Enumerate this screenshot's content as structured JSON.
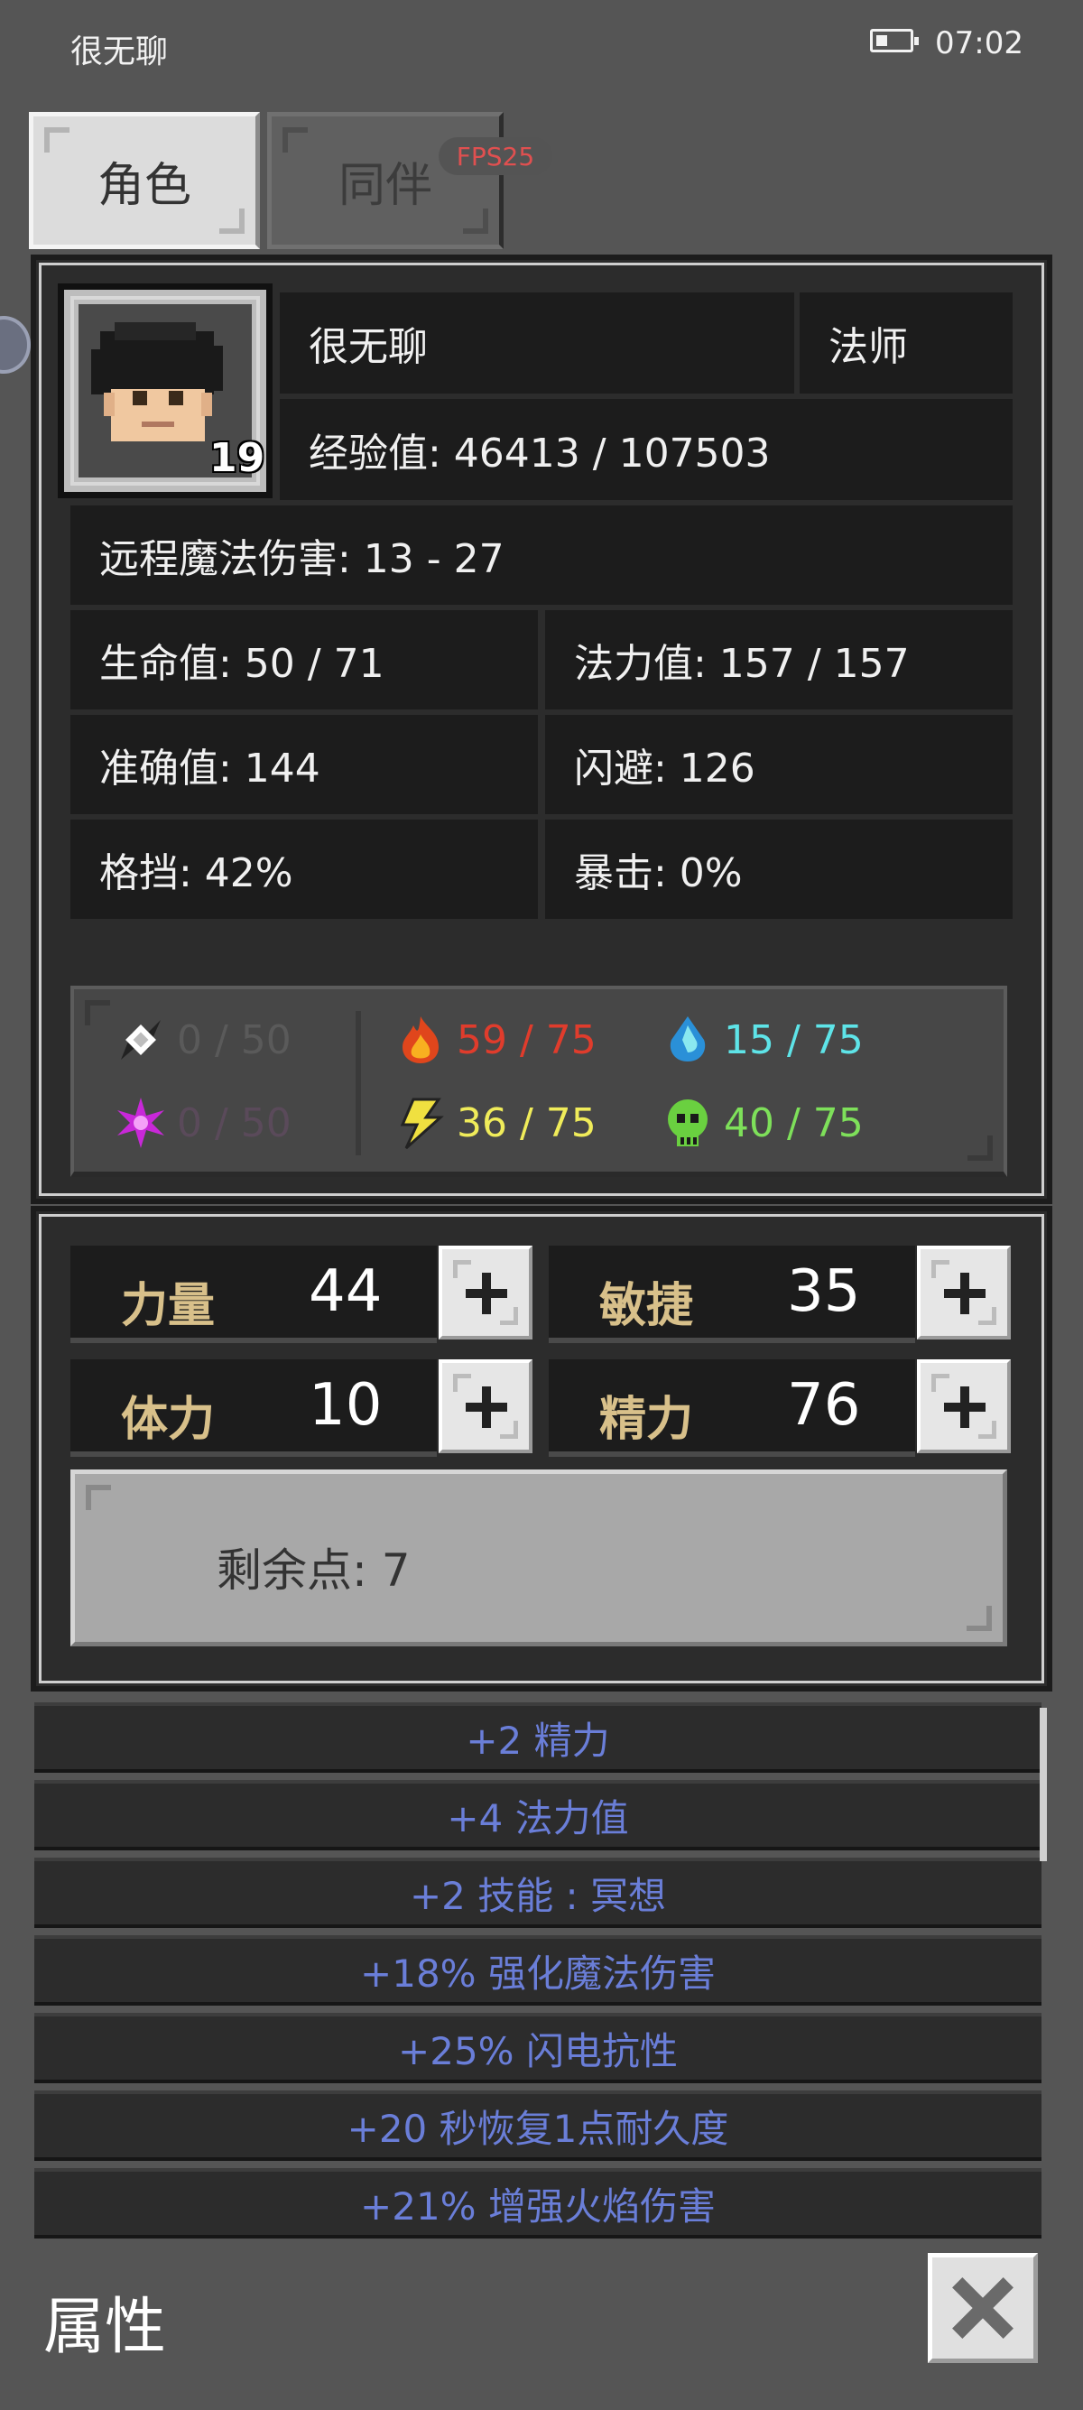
{
  "status_bar": {
    "app_name": "很无聊",
    "time": "07:02"
  },
  "tabs": [
    {
      "label": "角色",
      "active": true
    },
    {
      "label": "同伴",
      "active": false
    }
  ],
  "fps_badge": "FPS25",
  "character": {
    "name": "很无聊",
    "class": "法师",
    "level": "19",
    "experience": "经验值: 46413 / 107503",
    "damage": "远程魔法伤害: 13 - 27",
    "hp": "生命值: 50 / 71",
    "mp": "法力值: 157 / 157",
    "accuracy": "准确值: 144",
    "evasion": "闪避: 126",
    "block": "格挡: 42%",
    "critical": "暴击: 0%"
  },
  "resistances": [
    {
      "icon": "physical-icon",
      "value": "0 / 50",
      "color": "#5a5a5a"
    },
    {
      "icon": "fire-icon",
      "value": "59 / 75",
      "color": "#e03c2c"
    },
    {
      "icon": "water-icon",
      "value": "15 / 75",
      "color": "#5ee4e8"
    },
    {
      "icon": "arcane-icon",
      "value": "0 / 50",
      "color": "#5a4a5a"
    },
    {
      "icon": "lightning-icon",
      "value": "36 / 75",
      "color": "#f0ec5a"
    },
    {
      "icon": "poison-icon",
      "value": "40 / 75",
      "color": "#7ee05a"
    }
  ],
  "attributes": [
    {
      "name": "力量",
      "value": "44"
    },
    {
      "name": "敏捷",
      "value": "35"
    },
    {
      "name": "体力",
      "value": "10"
    },
    {
      "name": "精力",
      "value": "76"
    }
  ],
  "remaining_points": "剩余点: 7",
  "effects": [
    "+2 精力",
    "+4 法力值",
    "+2 技能 : 冥想",
    "+18% 强化魔法伤害",
    "+25% 闪电抗性",
    "+20 秒恢复1点耐久度",
    "+21% 增强火焰伤害"
  ],
  "footer": {
    "title": "属性"
  }
}
